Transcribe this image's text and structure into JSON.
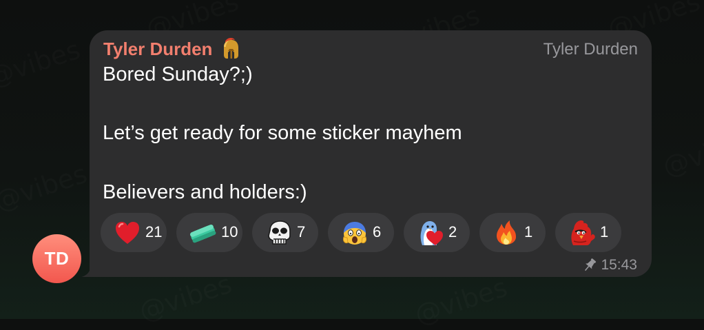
{
  "message": {
    "sender_name": "Tyler Durden",
    "sender_emoji": "spartan-helmet-icon",
    "author_signature": "Tyler Durden",
    "lines": [
      "Bored Sunday?;)",
      "Let’s get ready for some sticker mayhem",
      "Believers and holders:)"
    ],
    "time": "15:43",
    "pinned": true
  },
  "avatar": {
    "initials": "TD",
    "color": "#f2574e"
  },
  "reactions": [
    {
      "icon": "red-heart-icon",
      "count": "21"
    },
    {
      "icon": "green-pill-icon",
      "count": "10"
    },
    {
      "icon": "ape-skull-icon",
      "count": "7"
    },
    {
      "icon": "screaming-face-icon",
      "count": "6"
    },
    {
      "icon": "penguin-heart-icon",
      "count": "2"
    },
    {
      "icon": "fire-icon",
      "count": "1"
    },
    {
      "icon": "red-bird-icon",
      "count": "1"
    }
  ],
  "colors": {
    "bubble": "#2d2d2e",
    "sender_name": "#f27f6e",
    "chip": "#3b3b3d",
    "meta_text": "#98989c"
  }
}
